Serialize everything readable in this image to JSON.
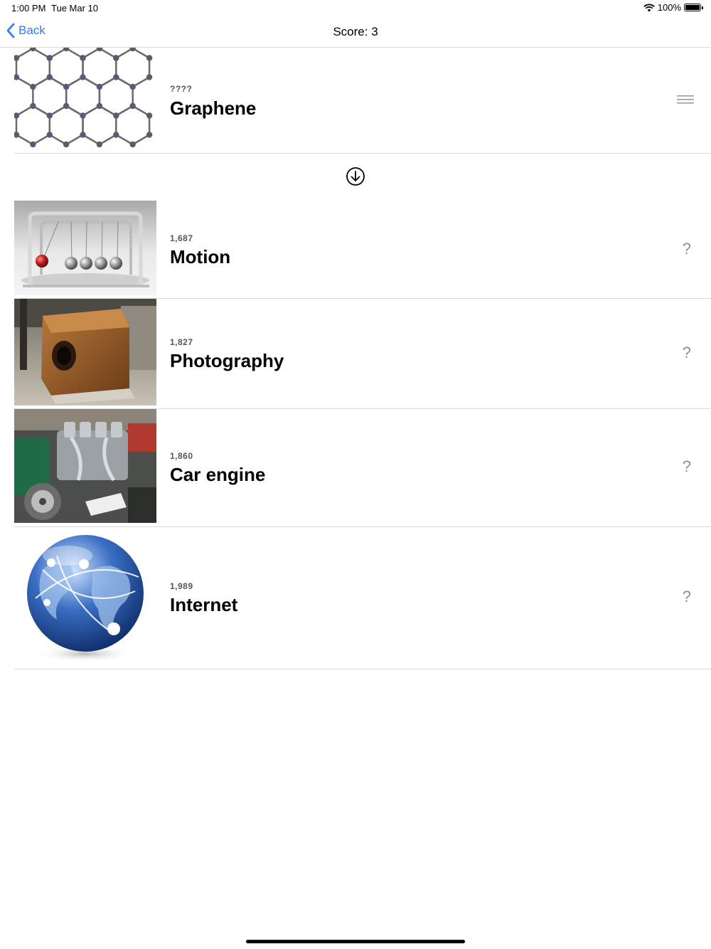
{
  "status_bar": {
    "time": "1:00 PM",
    "date": "Tue Mar 10",
    "battery": "100%"
  },
  "nav": {
    "back_label": "Back",
    "title": "Score: 3"
  },
  "current_card": {
    "year": "????",
    "name": "Graphene",
    "image_icon": "graphene-lattice-image",
    "accessory_icon": "reorder-handle-icon"
  },
  "placement_hint_icon": "arrow-down-circle-icon",
  "timeline": [
    {
      "year": "1,687",
      "name": "Motion",
      "image_icon": "newtons-cradle-image",
      "accessory": "?"
    },
    {
      "year": "1,827",
      "name": "Photography",
      "image_icon": "camera-box-image",
      "accessory": "?"
    },
    {
      "year": "1,860",
      "name": "Car engine",
      "image_icon": "car-engine-image",
      "accessory": "?"
    },
    {
      "year": "1,989",
      "name": "Internet",
      "image_icon": "internet-globe-image",
      "accessory": "?"
    }
  ],
  "colors": {
    "accent": "#2f7cf6",
    "separator": "#dcdcdc",
    "secondary_text": "#8e8e93"
  }
}
